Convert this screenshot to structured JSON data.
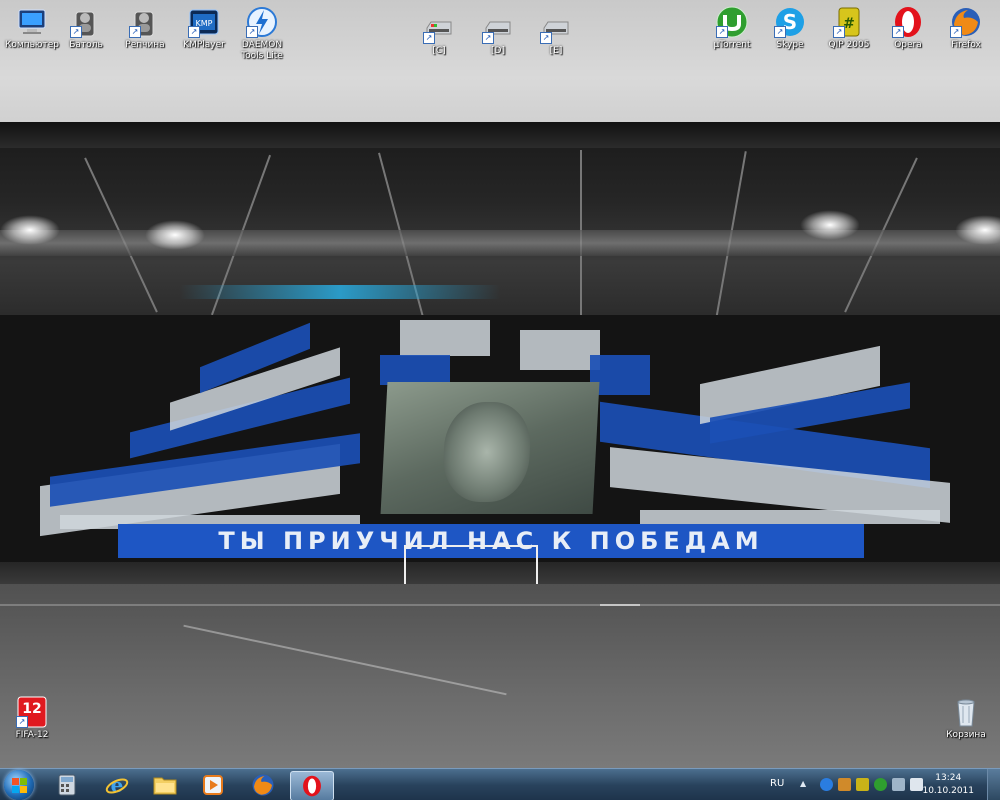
{
  "desktop": {
    "icons_top": [
      {
        "label": "Компьютер",
        "icon": "computer-icon"
      },
      {
        "label": "Батоль",
        "icon": "user-folder-icon"
      },
      {
        "label": "Репчина",
        "icon": "user-folder-icon"
      },
      {
        "label": "KMPlayer",
        "icon": "kmplayer-icon"
      },
      {
        "label": "DAEMON Tools Lite",
        "icon": "daemon-tools-icon"
      },
      {
        "label": "[C]",
        "icon": "drive-icon"
      },
      {
        "label": "[D]",
        "icon": "drive-icon"
      },
      {
        "label": "[E]",
        "icon": "drive-icon"
      },
      {
        "label": "µTorrent",
        "icon": "utorrent-icon"
      },
      {
        "label": "Skype",
        "icon": "skype-icon"
      },
      {
        "label": "QIP 2005",
        "icon": "qip-icon"
      },
      {
        "label": "Opera",
        "icon": "opera-icon"
      },
      {
        "label": "Firefox",
        "icon": "firefox-icon"
      }
    ],
    "fifa": {
      "label": "FIFA-12",
      "badge": "12"
    },
    "recycle_bin": {
      "label": "Корзина"
    },
    "wallpaper_banner": "ТЫ ПРИУЧИЛ НАС К ПОБЕДАМ"
  },
  "taskbar": {
    "pinned": [
      "calculator-icon",
      "internet-explorer-icon",
      "explorer-folder-icon",
      "media-player-icon",
      "firefox-icon",
      "opera-icon"
    ],
    "active_index": 5,
    "language": "RU",
    "time": "13:24",
    "date": "10.10.2011",
    "tray_up_arrow": "▲"
  },
  "colors": {
    "taskbar": "#29435d",
    "banner_blue": "#1e56c4"
  }
}
